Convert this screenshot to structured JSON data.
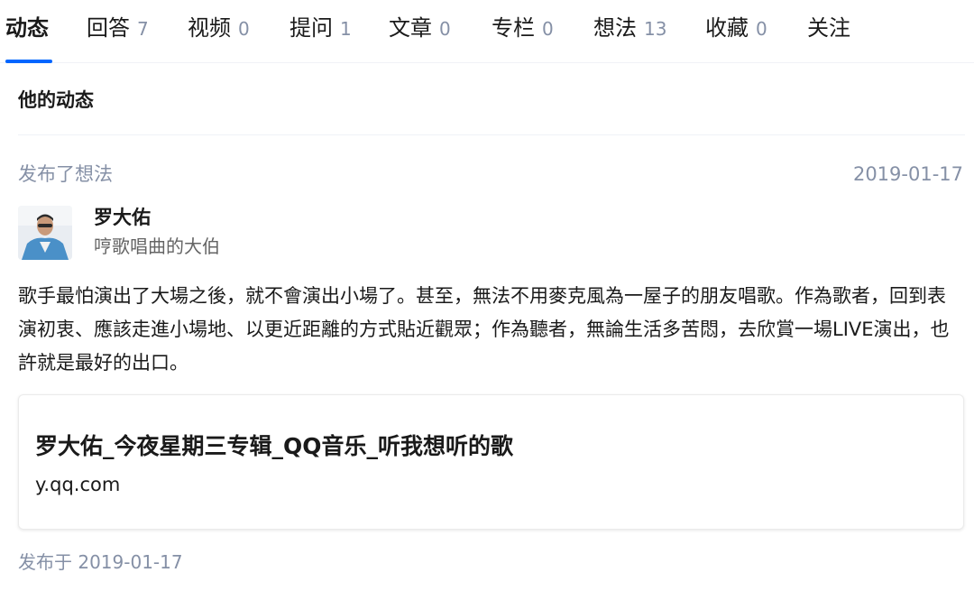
{
  "tabs": [
    {
      "label": "动态",
      "count": ""
    },
    {
      "label": "回答",
      "count": "7"
    },
    {
      "label": "视频",
      "count": "0"
    },
    {
      "label": "提问",
      "count": "1"
    },
    {
      "label": "文章",
      "count": "0"
    },
    {
      "label": "专栏",
      "count": "0"
    },
    {
      "label": "想法",
      "count": "13"
    },
    {
      "label": "收藏",
      "count": "0"
    },
    {
      "label": "关注",
      "count": ""
    }
  ],
  "section": {
    "title": "他的动态"
  },
  "activity": {
    "action": "发布了想法",
    "date": "2019-01-17",
    "author": {
      "name": "罗大佑",
      "bio": "哼歌唱曲的大伯"
    },
    "content": "歌手最怕演出了大場之後，就不會演出小場了。甚至，無法不用麥克風為一屋子的朋友唱歌。作為歌者，回到表演初衷、應該走進小場地、以更近距離的方式貼近觀眾；作為聽者，無論生活多苦悶，去欣賞一場LIVE演出，也許就是最好的出口。",
    "card": {
      "title": "罗大佑_今夜星期三专辑_QQ音乐_听我想听的歌",
      "url": "y.qq.com"
    },
    "published": "发布于 2019-01-17"
  },
  "colors": {
    "accent": "#0066ff",
    "meta": "#8590a6"
  }
}
